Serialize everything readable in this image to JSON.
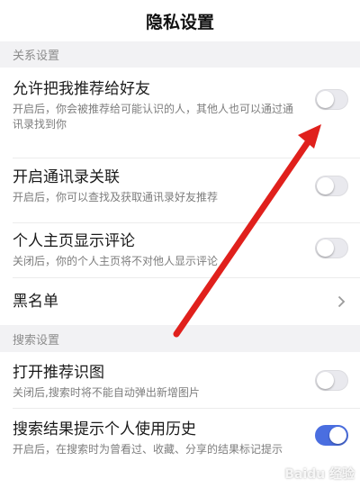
{
  "page_title": "隐私设置",
  "sections": [
    {
      "header": "关系设置",
      "items": [
        {
          "title": "允许把我推荐给好友",
          "desc": "开启后，你会被推荐给可能认识的人，其他人也可以通过通讯录找到你",
          "control": "toggle",
          "state": "off"
        },
        {
          "title": "开启通讯录关联",
          "desc": "开启后，你可以查找及获取通讯录好友推荐",
          "control": "toggle",
          "state": "off"
        },
        {
          "title": "个人主页显示评论",
          "desc": "关闭后，你的个人主页将不对他人显示评论",
          "control": "toggle",
          "state": "off"
        },
        {
          "title": "黑名单",
          "control": "chevron"
        }
      ]
    },
    {
      "header": "搜索设置",
      "items": [
        {
          "title": "打开推荐识图",
          "desc": "关闭后,搜索时将不能自动弹出新增图片",
          "control": "toggle",
          "state": "off"
        },
        {
          "title": "搜索结果提示个人使用历史",
          "desc": "开启后，在搜索时为曾看过、收藏、分享的结果标记提示",
          "control": "toggle",
          "state": "on"
        }
      ]
    }
  ],
  "watermark": "Baidu 经验",
  "colors": {
    "toggle_on": "#4a6ee0",
    "toggle_off": "#e9e9ee",
    "annotation_arrow": "#e0201c",
    "section_bg": "#f2f2f4"
  },
  "icons": {
    "chevron": "chevron-right-icon"
  }
}
